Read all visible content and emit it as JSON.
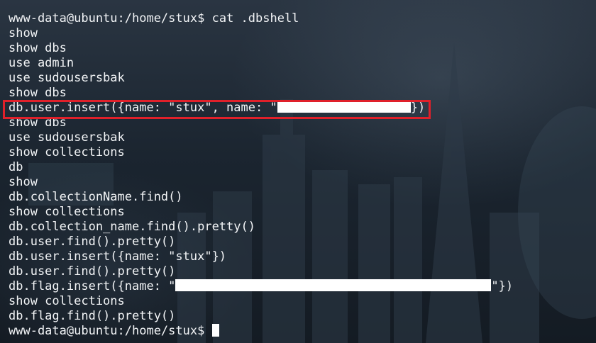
{
  "terminal": {
    "prompt": "www-data@ubuntu:/home/stux$",
    "command": "cat .dbshell",
    "lines": {
      "l1": "show",
      "l2": "show dbs",
      "l3": "use admin",
      "l4": "use sudousersbak",
      "l5": "show dbs",
      "l6_prefix": "db.user.insert({name: \"stux\", name: \"",
      "l6_suffix": "})",
      "l7": "show dbs",
      "l8": "use sudousersbak",
      "l9": "show collections",
      "l10": "db",
      "l11": "show",
      "l12": "db.collectionName.find()",
      "l13": "show collections",
      "l14": "db.collection_name.find().pretty()",
      "l15": "db.user.find().pretty()",
      "l16": "db.user.insert({name: \"stux\"})",
      "l17": "db.user.find().pretty()",
      "l18_prefix": "db.flag.insert({name: \"",
      "l18_suffix": "\"})",
      "l19": "show collections",
      "l20": "db.flag.find().pretty()"
    }
  },
  "colors": {
    "text": "#f2f4f6",
    "highlight": "#e0202a",
    "redaction": "#ffffff"
  }
}
